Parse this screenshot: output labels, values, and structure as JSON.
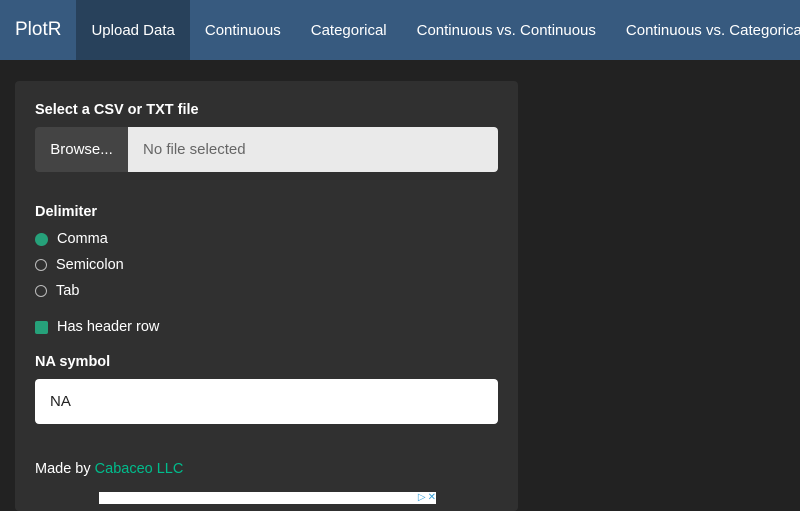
{
  "app": {
    "brand": "PlotR"
  },
  "nav": {
    "tabs": [
      {
        "label": "Upload Data",
        "active": true
      },
      {
        "label": "Continuous",
        "active": false
      },
      {
        "label": "Categorical",
        "active": false
      },
      {
        "label": "Continuous vs. Continuous",
        "active": false
      },
      {
        "label": "Continuous vs. Categorical",
        "active": false
      }
    ]
  },
  "upload": {
    "file_label": "Select a CSV or TXT file",
    "browse_label": "Browse...",
    "file_status": "No file selected",
    "delimiter_label": "Delimiter",
    "delimiter_options": [
      {
        "label": "Comma",
        "selected": true
      },
      {
        "label": "Semicolon",
        "selected": false
      },
      {
        "label": "Tab",
        "selected": false
      }
    ],
    "header_label": "Has header row",
    "header_checked": true,
    "na_label": "NA symbol",
    "na_value": "NA"
  },
  "footer": {
    "made_by": "Made by",
    "author": "Cabaceo LLC"
  },
  "icons": {
    "ad_choices": "adchoices-icon",
    "ad_close": "close-icon"
  },
  "colors": {
    "navbar": "#375a7f",
    "active_tab": "#28415b",
    "accent": "#26a17a",
    "link": "#00bc8c",
    "page_bg": "#222222",
    "panel_bg": "#303030"
  }
}
